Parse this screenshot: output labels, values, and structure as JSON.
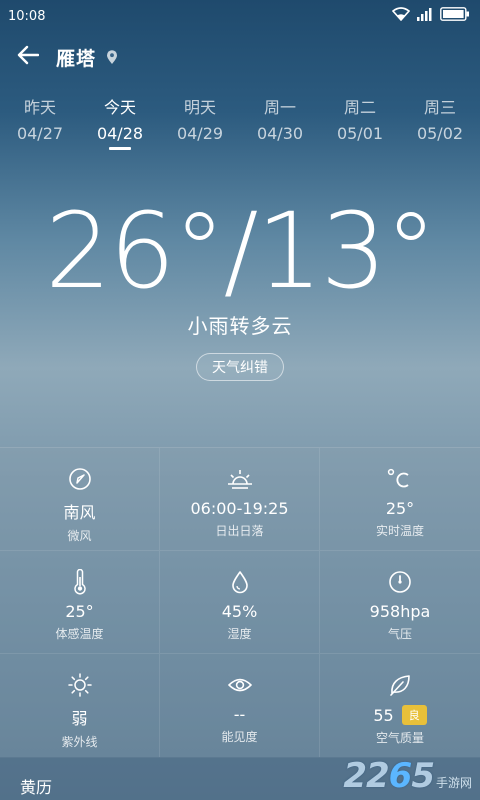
{
  "status_bar": {
    "time": "10:08"
  },
  "header": {
    "city": "雁塔"
  },
  "tabs": [
    {
      "day": "昨天",
      "date": "04/27"
    },
    {
      "day": "今天",
      "date": "04/28"
    },
    {
      "day": "明天",
      "date": "04/29"
    },
    {
      "day": "周一",
      "date": "04/30"
    },
    {
      "day": "周二",
      "date": "05/01"
    },
    {
      "day": "周三",
      "date": "05/02"
    }
  ],
  "main": {
    "temperature": "26°/13°",
    "condition": "小雨转多云",
    "correct_label": "天气纠错"
  },
  "details": [
    {
      "value": "南风",
      "label": "微风",
      "icon": "compass-icon"
    },
    {
      "value": "06:00-19:25",
      "label": "日出日落",
      "icon": "sunrise-icon"
    },
    {
      "value": "25°",
      "label": "实时温度",
      "icon": "celsius-icon"
    },
    {
      "value": "25°",
      "label": "体感温度",
      "icon": "thermometer-icon"
    },
    {
      "value": "45%",
      "label": "湿度",
      "icon": "drop-icon"
    },
    {
      "value": "958hpa",
      "label": "气压",
      "icon": "gauge-icon"
    },
    {
      "value": "弱",
      "label": "紫外线",
      "icon": "sun-icon"
    },
    {
      "value": "--",
      "label": "能见度",
      "icon": "eye-icon"
    },
    {
      "value": "55",
      "label": "空气质量",
      "badge": "良",
      "icon": "leaf-icon"
    }
  ],
  "almanac": {
    "label": "黄历"
  },
  "watermark": {
    "number_prefix": "22",
    "number_highlight": "6",
    "number_suffix": "5",
    "text": "手游网"
  },
  "colors": {
    "aqi_badge": "#e8c03a",
    "watermark_highlight": "#5bb6ff"
  }
}
